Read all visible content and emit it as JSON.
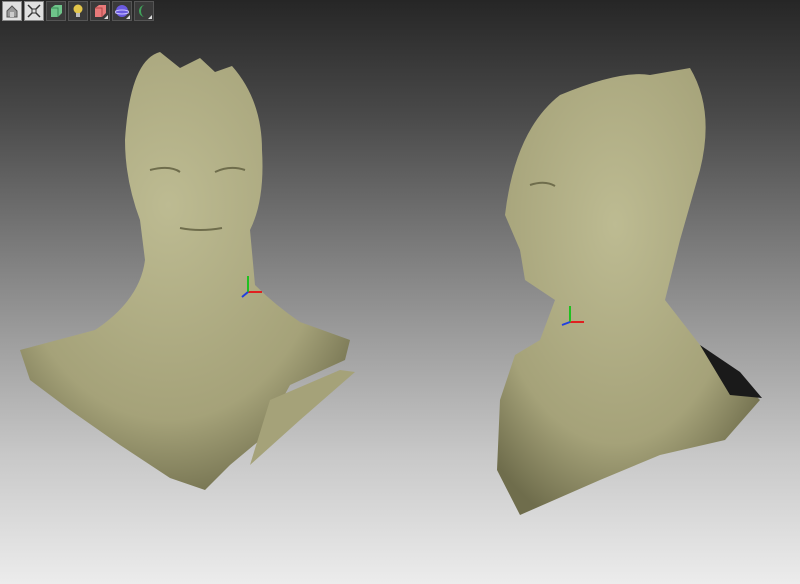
{
  "toolbar": {
    "buttons": [
      {
        "icon": "home-view-icon",
        "color": "#d8d8d8"
      },
      {
        "icon": "fit-view-icon",
        "color": "#d8d8d8"
      },
      {
        "icon": "green-cube-icon",
        "color": "#6fc48a"
      },
      {
        "icon": "light-bulb-icon",
        "color": "#e3c64a"
      },
      {
        "icon": "red-cube-icon",
        "color": "#e87a7a"
      },
      {
        "icon": "purple-sphere-icon",
        "color": "#6a5ae0"
      },
      {
        "icon": "green-moon-icon",
        "color": "#3fa45a"
      }
    ]
  },
  "viewport": {
    "mesh_color": "#a9a67d",
    "axis_colors": {
      "x": "#e02020",
      "y": "#20c020",
      "z": "#2040e0"
    }
  }
}
